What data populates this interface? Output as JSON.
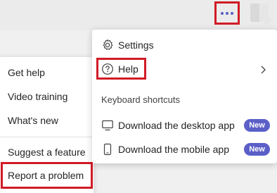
{
  "topbar": {
    "more_icon": "more-horizontal-icon",
    "avatar": "avatar"
  },
  "menu": {
    "settings_label": "Settings",
    "settings_icon": "gear-icon",
    "help_label": "Help",
    "help_icon": "question-circle-icon",
    "section_label": "Keyboard shortcuts",
    "download_desktop_label": "Download the desktop app",
    "download_desktop_icon": "monitor-icon",
    "download_mobile_label": "Download the mobile app",
    "download_mobile_icon": "phone-icon",
    "new_badge": "New"
  },
  "help_submenu": {
    "items": [
      "Get help",
      "Video training",
      "What's new",
      "Suggest a feature",
      "Report a problem"
    ]
  },
  "colors": {
    "highlight": "#d11b26",
    "accent": "#5b5fc7"
  }
}
